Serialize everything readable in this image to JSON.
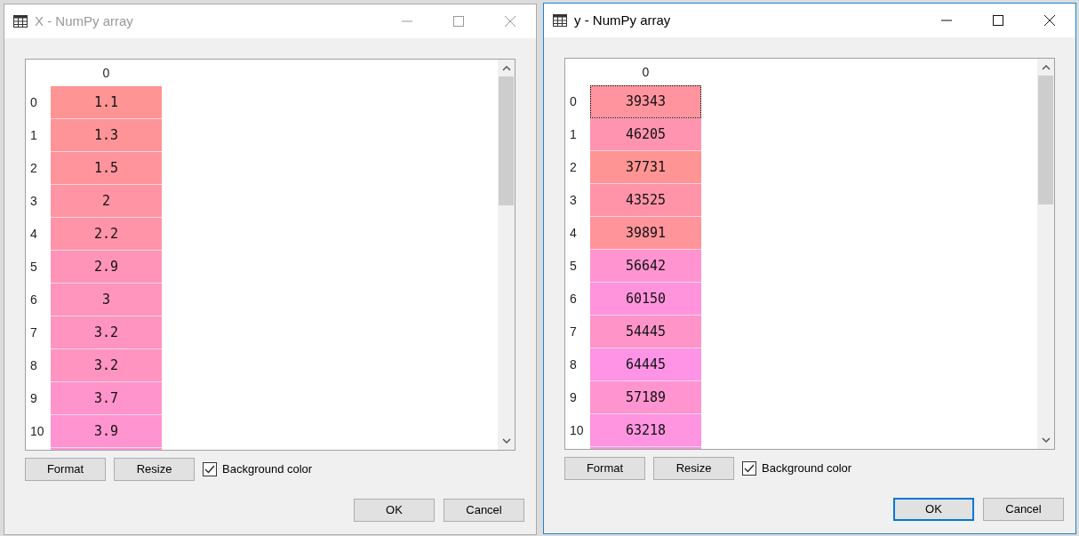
{
  "windows": [
    {
      "title": "X - NumPy array",
      "active": false,
      "column_header": "0",
      "rows": [
        {
          "index": "0",
          "value": "1.1",
          "color": "#ff9494",
          "selected": false
        },
        {
          "index": "1",
          "value": "1.3",
          "color": "#ff9498",
          "selected": false
        },
        {
          "index": "2",
          "value": "1.5",
          "color": "#ff949c",
          "selected": false
        },
        {
          "index": "3",
          "value": "2",
          "color": "#ff94a4",
          "selected": false
        },
        {
          "index": "4",
          "value": "2.2",
          "color": "#ff94a8",
          "selected": false
        },
        {
          "index": "5",
          "value": "2.9",
          "color": "#ff94b8",
          "selected": false
        },
        {
          "index": "6",
          "value": "3",
          "color": "#ff94bc",
          "selected": false
        },
        {
          "index": "7",
          "value": "3.2",
          "color": "#ff94c0",
          "selected": false
        },
        {
          "index": "8",
          "value": "3.2",
          "color": "#ff94c0",
          "selected": false
        },
        {
          "index": "9",
          "value": "3.7",
          "color": "#ff94cc",
          "selected": false
        },
        {
          "index": "10",
          "value": "3.9",
          "color": "#ff94d0",
          "selected": false
        }
      ],
      "buttons": [
        "Format",
        "Resize"
      ],
      "background_color": {
        "label": "Background color",
        "checked": true
      },
      "dialog_buttons": [
        {
          "label": "OK",
          "default": false
        },
        {
          "label": "Cancel",
          "default": false
        }
      ]
    },
    {
      "title": "y - NumPy array",
      "active": true,
      "column_header": "0",
      "rows": [
        {
          "index": "0",
          "value": "39343",
          "color": "#ff949e",
          "selected": true
        },
        {
          "index": "1",
          "value": "46205",
          "color": "#ff94b0",
          "selected": false
        },
        {
          "index": "2",
          "value": "37731",
          "color": "#ff9494",
          "selected": false
        },
        {
          "index": "3",
          "value": "43525",
          "color": "#ff94a8",
          "selected": false
        },
        {
          "index": "4",
          "value": "39891",
          "color": "#ff949a",
          "selected": false
        },
        {
          "index": "5",
          "value": "56642",
          "color": "#ff94d0",
          "selected": false
        },
        {
          "index": "6",
          "value": "60150",
          "color": "#ff94dc",
          "selected": false
        },
        {
          "index": "7",
          "value": "54445",
          "color": "#ff94c8",
          "selected": false
        },
        {
          "index": "8",
          "value": "64445",
          "color": "#ff94e6",
          "selected": false
        },
        {
          "index": "9",
          "value": "57189",
          "color": "#ff94d0",
          "selected": false
        },
        {
          "index": "10",
          "value": "63218",
          "color": "#ff94e0",
          "selected": false
        }
      ],
      "buttons": [
        "Format",
        "Resize"
      ],
      "background_color": {
        "label": "Background color",
        "checked": true
      },
      "dialog_buttons": [
        {
          "label": "OK",
          "default": true
        },
        {
          "label": "Cancel",
          "default": false
        }
      ]
    }
  ]
}
